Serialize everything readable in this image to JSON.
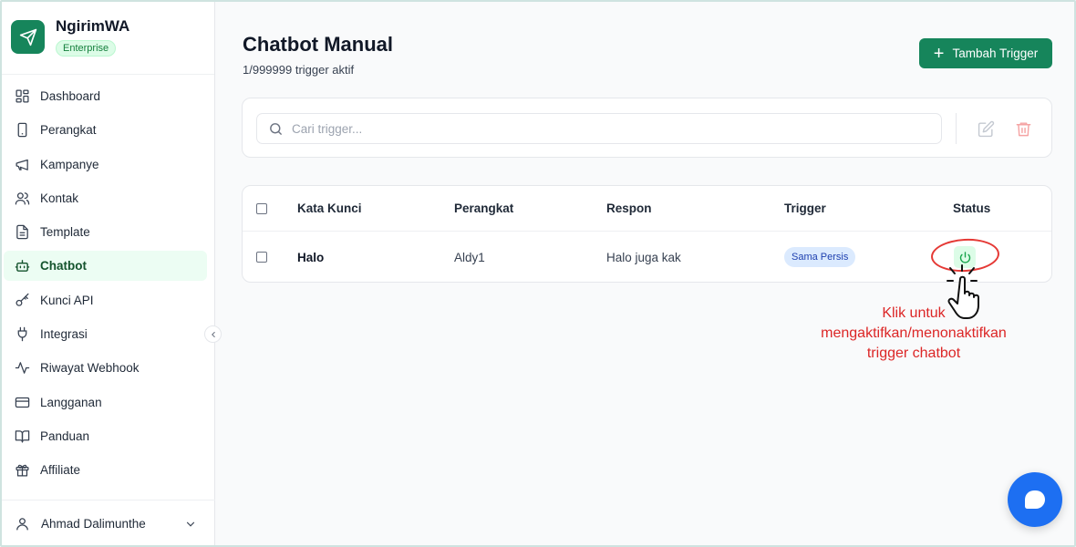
{
  "brand": {
    "name": "NgirimWA",
    "plan": "Enterprise"
  },
  "sidebar": {
    "items": [
      {
        "label": "Dashboard",
        "icon": "dashboard-icon"
      },
      {
        "label": "Perangkat",
        "icon": "device-icon"
      },
      {
        "label": "Kampanye",
        "icon": "megaphone-icon"
      },
      {
        "label": "Kontak",
        "icon": "users-icon"
      },
      {
        "label": "Template",
        "icon": "file-text-icon"
      },
      {
        "label": "Chatbot",
        "icon": "bot-icon",
        "active": true
      },
      {
        "label": "Kunci API",
        "icon": "key-icon"
      },
      {
        "label": "Integrasi",
        "icon": "plug-icon"
      },
      {
        "label": "Riwayat Webhook",
        "icon": "activity-icon"
      },
      {
        "label": "Langganan",
        "icon": "credit-card-icon"
      },
      {
        "label": "Panduan",
        "icon": "book-icon"
      },
      {
        "label": "Affiliate",
        "icon": "gift-icon"
      }
    ],
    "user": {
      "name": "Ahmad Dalimunthe"
    }
  },
  "page": {
    "title": "Chatbot Manual",
    "subtitle": "1/999999 trigger aktif",
    "add_button": "Tambah Trigger"
  },
  "search": {
    "placeholder": "Cari trigger..."
  },
  "table": {
    "headers": {
      "keyword": "Kata Kunci",
      "device": "Perangkat",
      "response": "Respon",
      "trigger": "Trigger",
      "status": "Status"
    },
    "rows": [
      {
        "keyword": "Halo",
        "device": "Aldy1",
        "response": "Halo juga kak",
        "trigger": "Sama Persis",
        "status_active": true
      }
    ]
  },
  "annotation": {
    "line1": "Klik untuk",
    "line2": "mengaktifkan/menonaktifkan",
    "line3": "trigger chatbot"
  },
  "colors": {
    "primary": "#16855b",
    "annotation": "#dc2626",
    "chat": "#1d6ff2",
    "badge_bg": "#dbeafe"
  }
}
